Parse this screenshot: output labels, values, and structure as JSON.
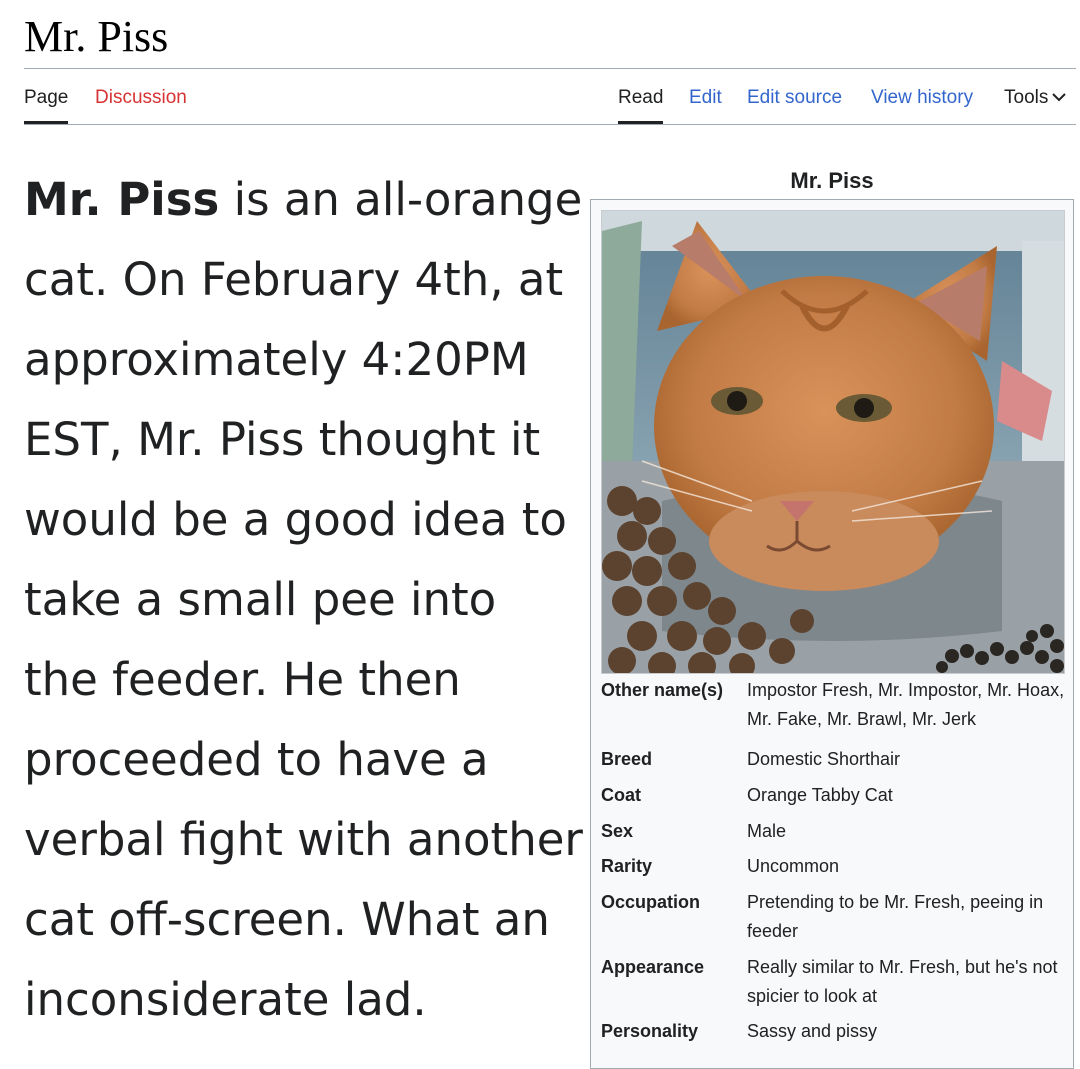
{
  "page": {
    "title": "Mr. Piss"
  },
  "tabs": {
    "page": "Page",
    "discussion": "Discussion",
    "read": "Read",
    "edit": "Edit",
    "edit_source": "Edit source",
    "view_history": "View history",
    "tools": "Tools"
  },
  "article": {
    "subject": "Mr. Piss",
    "lead_rest": " is an all-orange cat. On February 4th, at approximately 4:20PM EST, Mr. Piss thought it would be a good idea to take a small pee into the feeder. He then proceeded to have a verbal fight with another cat off-screen. What an inconsiderate lad."
  },
  "infobox": {
    "caption": "Mr. Piss",
    "image": "orange tabby cat at feeder",
    "rows": [
      {
        "label": "Other name(s)",
        "value": "Impostor Fresh, Mr. Impostor, Mr. Hoax, Mr. Fake, Mr. Brawl, Mr. Jerk"
      },
      {
        "label": "Breed",
        "value": "Domestic Shorthair"
      },
      {
        "label": "Coat",
        "value": "Orange Tabby Cat"
      },
      {
        "label": "Sex",
        "value": "Male"
      },
      {
        "label": "Rarity",
        "value": "Uncommon"
      },
      {
        "label": "Occupation",
        "value": "Pretending to be Mr. Fresh, peeing in feeder"
      },
      {
        "label": "Appearance",
        "value": "Really similar to Mr. Fresh, but he's not spicier to look at"
      },
      {
        "label": "Personality",
        "value": "Sassy and pissy"
      }
    ]
  },
  "colors": {
    "link": "#3366cc",
    "link_red": "#d73333",
    "text": "#202122",
    "border": "#a2a9b1",
    "infobox_bg": "#f8f9fa"
  }
}
